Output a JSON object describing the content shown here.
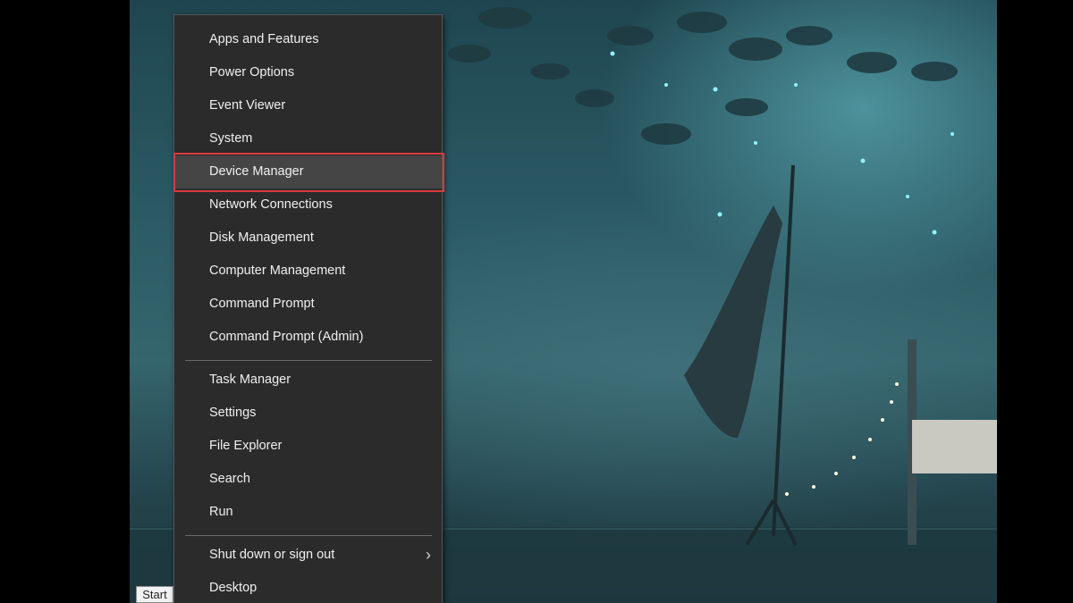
{
  "start_tooltip": "Start",
  "menu": {
    "group1": [
      {
        "label": "Apps and Features"
      },
      {
        "label": "Power Options"
      },
      {
        "label": "Event Viewer"
      },
      {
        "label": "System"
      },
      {
        "label": "Device Manager"
      },
      {
        "label": "Network Connections"
      },
      {
        "label": "Disk Management"
      },
      {
        "label": "Computer Management"
      },
      {
        "label": "Command Prompt"
      },
      {
        "label": "Command Prompt (Admin)"
      }
    ],
    "group2": [
      {
        "label": "Task Manager"
      },
      {
        "label": "Settings"
      },
      {
        "label": "File Explorer"
      },
      {
        "label": "Search"
      },
      {
        "label": "Run"
      }
    ],
    "group3": [
      {
        "label": "Shut down or sign out",
        "submenu_icon": "chevron-right-icon"
      },
      {
        "label": "Desktop"
      }
    ],
    "selected_item": "Device Manager"
  },
  "colors": {
    "menu_background": "#2b2b2b",
    "highlight_outline": "#d9393f",
    "menu_text": "#f0f0f0"
  }
}
